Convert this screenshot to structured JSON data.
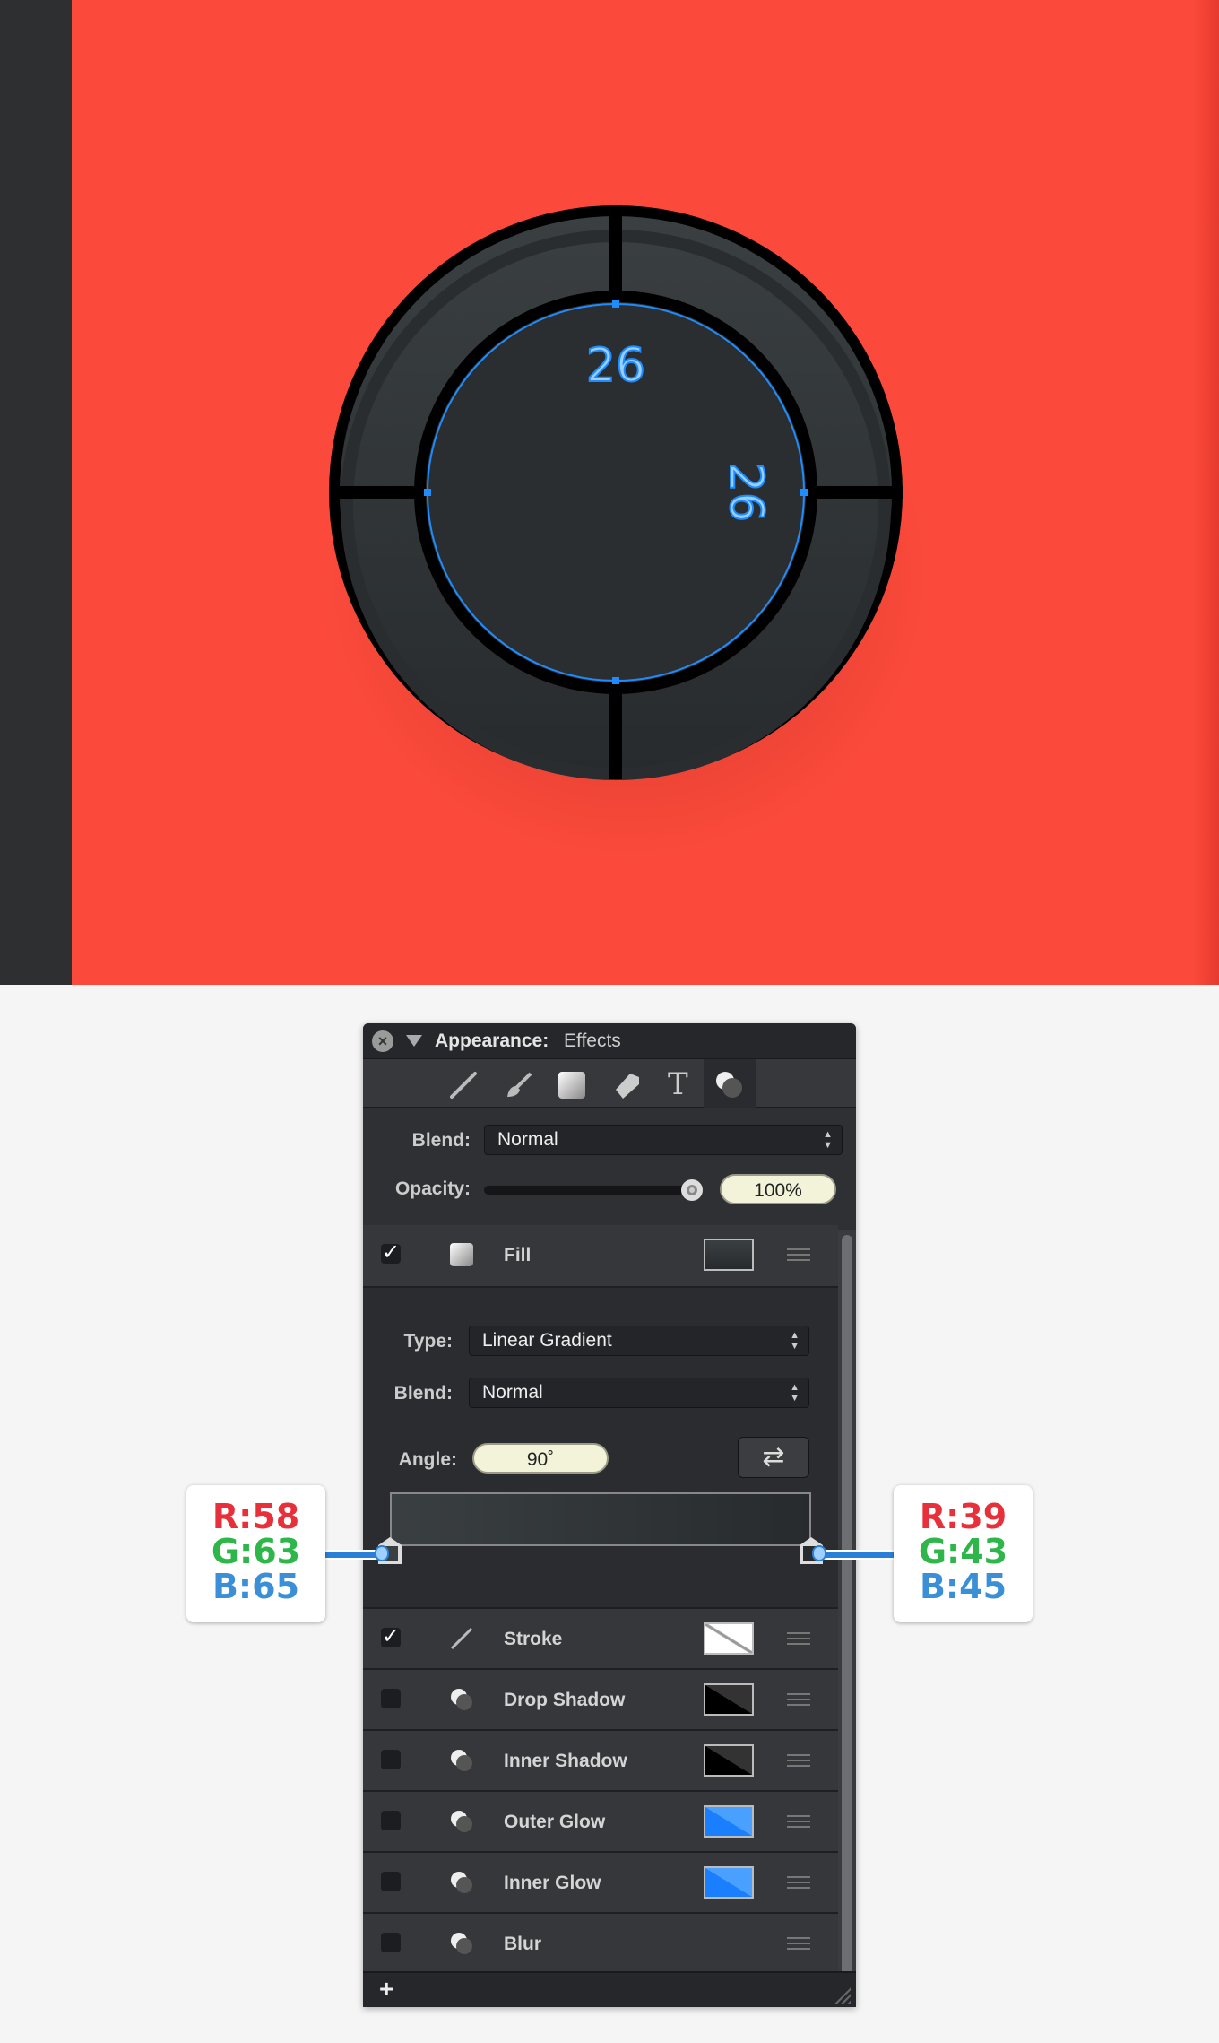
{
  "artwork": {
    "label_top": "26",
    "label_right": "26",
    "colors": {
      "background": "#fb4a3b",
      "ring": "#3a3f41",
      "guide": "#1e8cff"
    }
  },
  "panel": {
    "title": "Appearance:",
    "subtitle": "Effects",
    "toolbar": [
      "line-tool-icon",
      "brush-icon",
      "fill-icon",
      "tag-icon",
      "text-icon",
      "effects-icon"
    ],
    "toolbar_text_glyph": "T",
    "blend_label": "Blend:",
    "blend_value": "Normal",
    "opacity_label": "Opacity:",
    "opacity_value": "100%",
    "opacity_fraction": 1.0,
    "fill": {
      "label": "Fill",
      "checked": true,
      "check": "✓"
    },
    "type_label": "Type:",
    "type_value": "Linear Gradient",
    "fill_blend_label": "Blend:",
    "fill_blend_value": "Normal",
    "angle_label": "Angle:",
    "angle_value": "90˚",
    "gradient": {
      "start": "#3a3f41",
      "end": "#272b2d"
    },
    "effects": [
      {
        "label": "Stroke",
        "checked": true,
        "check": "✓"
      },
      {
        "label": "Drop Shadow",
        "checked": false
      },
      {
        "label": "Inner Shadow",
        "checked": false
      },
      {
        "label": "Outer Glow",
        "checked": false
      },
      {
        "label": "Inner Glow",
        "checked": false
      },
      {
        "label": "Blur",
        "checked": false
      }
    ],
    "add_label": "+"
  },
  "callouts": {
    "left": {
      "r": "R:58",
      "g": "G:63",
      "b": "B:65"
    },
    "right": {
      "r": "R:39",
      "g": "G:43",
      "b": "B:45"
    }
  }
}
